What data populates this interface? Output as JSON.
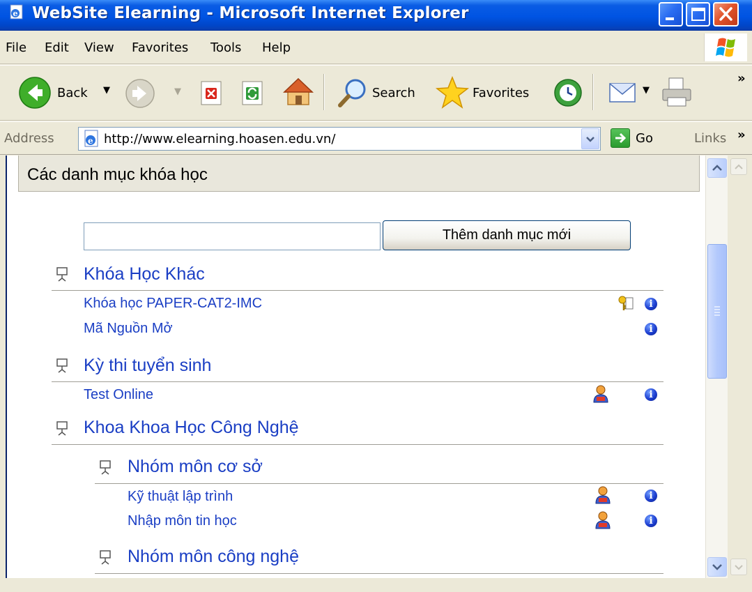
{
  "window": {
    "title": "WebSite Elearning - Microsoft Internet Explorer"
  },
  "menu": {
    "items": [
      "File",
      "Edit",
      "View",
      "Favorites",
      "Tools",
      "Help"
    ]
  },
  "toolbar": {
    "back_label": "Back",
    "search_label": "Search",
    "favorites_label": "Favorites"
  },
  "address": {
    "label": "Address",
    "url": "http://www.elearning.hoasen.edu.vn/",
    "go_label": "Go",
    "links_label": "Links"
  },
  "page": {
    "section_title": "Các danh mục khóa học",
    "new_category_input_value": "",
    "new_category_button": "Thêm danh mục mới",
    "categories": [
      {
        "title": "Khóa Học Khác",
        "courses": [
          {
            "name": "Khóa học PAPER-CAT2-IMC",
            "icons": [
              "key-icon",
              "info-icon"
            ]
          },
          {
            "name": "Mã Nguồn Mở",
            "icons": [
              "info-icon"
            ]
          }
        ]
      },
      {
        "title": "Kỳ thi tuyển sinh",
        "courses": [
          {
            "name": "Test Online",
            "icons": [
              "teacher-icon",
              "info-icon"
            ]
          }
        ]
      },
      {
        "title": "Khoa Khoa Học Công Nghệ",
        "courses": [],
        "subcategories": [
          {
            "title": "Nhóm môn cơ sở",
            "courses": [
              {
                "name": "Kỹ thuật lập trình",
                "icons": [
                  "teacher-icon",
                  "info-icon"
                ]
              },
              {
                "name": "Nhập môn tin học",
                "icons": [
                  "teacher-icon",
                  "info-icon"
                ]
              }
            ]
          },
          {
            "title": "Nhóm môn công nghệ",
            "courses": []
          }
        ]
      }
    ]
  },
  "colors": {
    "titlebar": "#0054e3",
    "link": "#1a3ec4",
    "chrome": "#ece9d8"
  }
}
